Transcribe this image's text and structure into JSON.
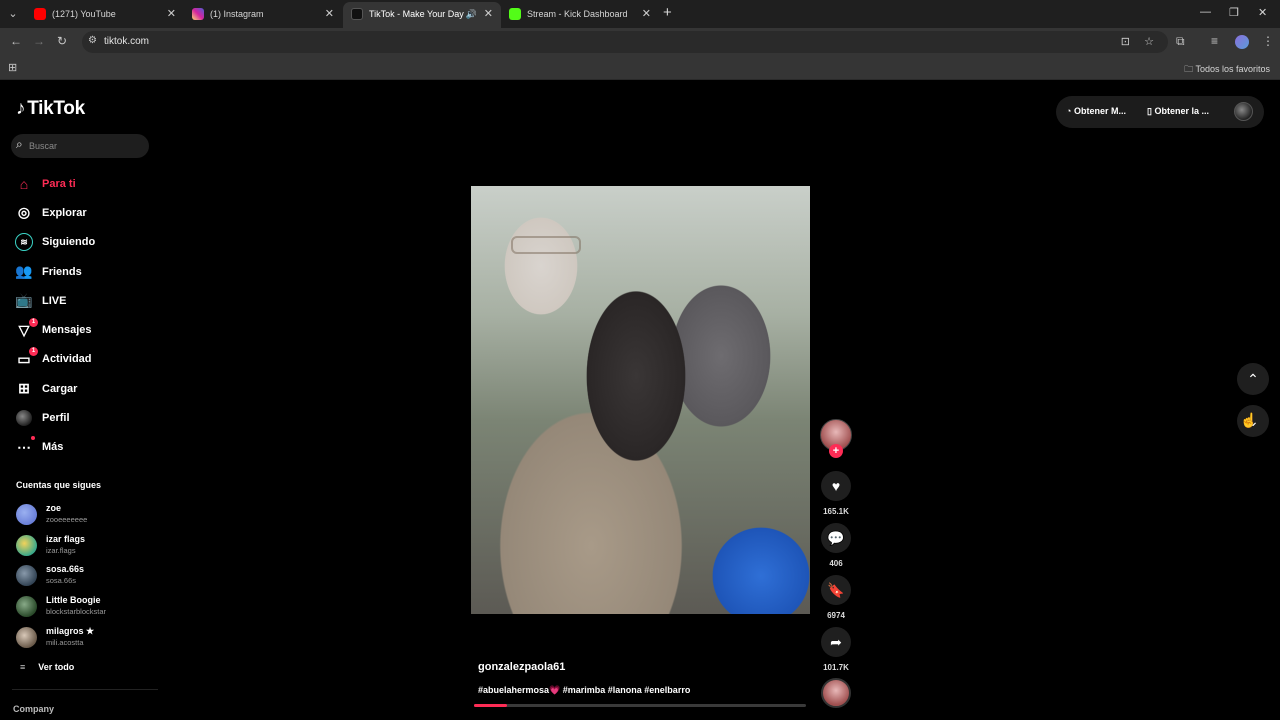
{
  "browser": {
    "tabs": [
      {
        "title": "(1271) YouTube",
        "favicon_color": "#ff0000"
      },
      {
        "title": "(1) Instagram",
        "favicon_color": "#d6249f"
      },
      {
        "title": "TikTok - Make Your Day",
        "favicon_color": "#111111",
        "active": true
      },
      {
        "title": "Stream - Kick Dashboard",
        "favicon_color": "#53fc18"
      }
    ],
    "url": "tiktok.com",
    "bookmarks_folder": "Todos los favoritos"
  },
  "tiktok": {
    "logo": "TikTok",
    "search_placeholder": "Buscar",
    "nav": [
      {
        "label": "Para ti",
        "icon": "home-icon",
        "active": true
      },
      {
        "label": "Explorar",
        "icon": "compass-icon"
      },
      {
        "label": "Siguiendo",
        "icon": "following-icon"
      },
      {
        "label": "Friends",
        "icon": "friends-icon"
      },
      {
        "label": "LIVE",
        "icon": "live-icon"
      },
      {
        "label": "Mensajes",
        "icon": "messages-icon",
        "badge": "1"
      },
      {
        "label": "Actividad",
        "icon": "activity-icon",
        "badge": "1"
      },
      {
        "label": "Cargar",
        "icon": "upload-icon"
      },
      {
        "label": "Perfil",
        "icon": "profile-icon"
      },
      {
        "label": "Más",
        "icon": "more-icon",
        "dot": true
      }
    ],
    "following_title": "Cuentas que sigues",
    "following": [
      {
        "name": "zoe",
        "handle": "zooeeeeeee",
        "color": "#6a7fd8"
      },
      {
        "name": "izar flags",
        "handle": "izar.flags",
        "color": "#3aa88a"
      },
      {
        "name": "sosa.66s",
        "handle": "sosa.66s",
        "color": "#556677"
      },
      {
        "name": "Little Boogie",
        "handle": "blockstarblockstar",
        "color": "#4a6a4a"
      },
      {
        "name": "milagros ★",
        "handle": "mili.acostta",
        "color": "#8a7a6a"
      }
    ],
    "see_all": "Ver todo",
    "company": "Company",
    "top_right": {
      "get_coins": "Obtener M...",
      "get_app": "Obtener la ..."
    },
    "video": {
      "author": "gonzalezpaola61",
      "caption_prefix": "#abuelahermosa",
      "caption_suffix": " #marimba #lanona #enelbarro",
      "progress": 0.1
    },
    "actions": {
      "likes": "165.1K",
      "comments": "406",
      "saves": "6974",
      "shares": "101.7K"
    }
  }
}
